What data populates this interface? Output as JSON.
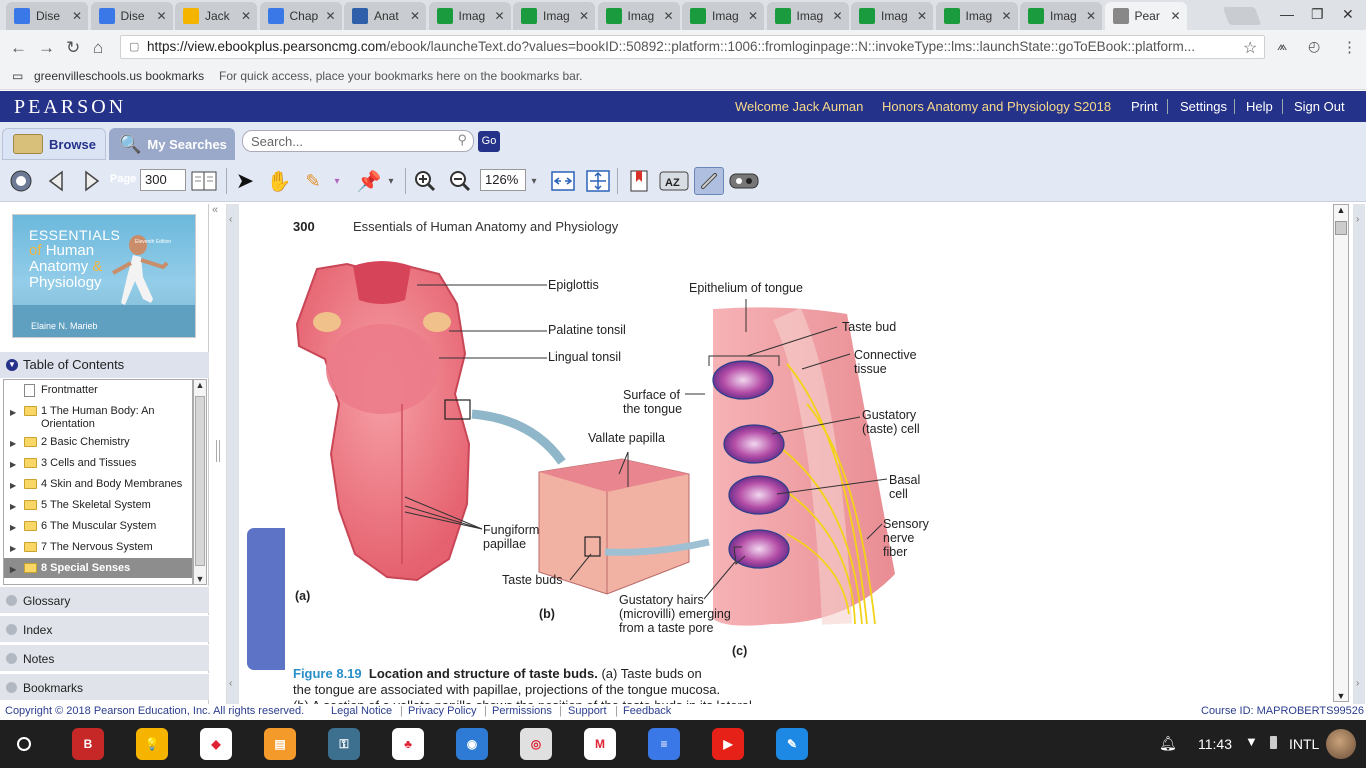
{
  "browser": {
    "tabs": [
      {
        "title": "Dise",
        "icon": "docs-icon",
        "color": "#3b78e7"
      },
      {
        "title": "Dise",
        "icon": "docs-icon",
        "color": "#3b78e7"
      },
      {
        "title": "Jack",
        "icon": "slides-icon",
        "color": "#f4b400"
      },
      {
        "title": "Chap",
        "icon": "docs-icon",
        "color": "#3b78e7"
      },
      {
        "title": "Anat",
        "icon": "classroom-icon",
        "color": "#2e5fa8"
      },
      {
        "title": "Imag",
        "icon": "iq-icon",
        "color": "#1a9c3e"
      },
      {
        "title": "Imag",
        "icon": "iq-icon",
        "color": "#1a9c3e"
      },
      {
        "title": "Imag",
        "icon": "iq-icon",
        "color": "#1a9c3e"
      },
      {
        "title": "Imag",
        "icon": "iq-icon",
        "color": "#1a9c3e"
      },
      {
        "title": "Imag",
        "icon": "iq-icon",
        "color": "#1a9c3e"
      },
      {
        "title": "Imag",
        "icon": "iq-icon",
        "color": "#1a9c3e"
      },
      {
        "title": "Imag",
        "icon": "iq-icon",
        "color": "#1a9c3e"
      },
      {
        "title": "Imag",
        "icon": "iq-icon",
        "color": "#1a9c3e"
      },
      {
        "title": "Pear",
        "icon": "page-icon",
        "color": "#888888",
        "active": true
      }
    ],
    "url_host": "https://view.ebookplus.pearsoncmg.com",
    "url_path": "/ebook/launcheText.do?values=bookID::50892::platform::1006::fromloginpage::N::invokeType::lms::launchState::goToEBook::platform...",
    "bookmarks_folder": "greenvilleschools.us bookmarks",
    "bookmarks_hint": "For quick access, place your bookmarks here on the bookmarks bar."
  },
  "header": {
    "logo": "PEARSON",
    "welcome": "Welcome Jack Auman",
    "course": "Honors Anatomy and Physiology S2018",
    "links": [
      "Print",
      "Settings",
      "Help",
      "Sign Out"
    ]
  },
  "toolbar": {
    "browse_label": "Browse",
    "searches_label": "My Searches",
    "search_placeholder": "Search...",
    "go_label": "Go",
    "page_label": "Page",
    "page_value": "300",
    "zoom_value": "126%"
  },
  "sidebar": {
    "cover": {
      "line1": "ESSENTIALS",
      "of": "of",
      "line2": "Human",
      "line3": "Anatomy",
      "amp": "&",
      "line4": "Physiology",
      "author": "Elaine N. Marieb",
      "edition": "Eleventh Edition"
    },
    "toc_title": "Table of Contents",
    "toc_items": [
      {
        "label": "Frontmatter",
        "kind": "page"
      },
      {
        "label": "1 The Human Body: An",
        "label2": "Orientation",
        "kind": "folder"
      },
      {
        "label": "2 Basic Chemistry",
        "kind": "folder"
      },
      {
        "label": "3 Cells and Tissues",
        "kind": "folder"
      },
      {
        "label": "4 Skin and Body Membranes",
        "kind": "folder"
      },
      {
        "label": "5 The Skeletal System",
        "kind": "folder"
      },
      {
        "label": "6 The Muscular System",
        "kind": "folder"
      },
      {
        "label": "7 The Nervous System",
        "kind": "folder"
      },
      {
        "label": "8 Special Senses",
        "kind": "folder",
        "selected": true
      }
    ],
    "sections": [
      "Glossary",
      "Index",
      "Notes",
      "Bookmarks"
    ]
  },
  "page": {
    "number": "300",
    "running_head": "Essentials of Human Anatomy and Physiology",
    "figure_labels": {
      "epiglottis": "Epiglottis",
      "palatine": "Palatine tonsil",
      "lingual": "Lingual tonsil",
      "fungiform1": "Fungiform",
      "fungiform2": "papillae",
      "a": "(a)",
      "vallate": "Vallate papilla",
      "taste_buds": "Taste buds",
      "b": "(b)",
      "surface1": "Surface of",
      "surface2": "the tongue",
      "epithelium": "Epithelium of tongue",
      "taste_bud": "Taste bud",
      "connective1": "Connective",
      "connective2": "tissue",
      "gustatory1": "Gustatory",
      "gustatory2": "(taste) cell",
      "basal1": "Basal",
      "basal2": "cell",
      "sensory1": "Sensory",
      "sensory2": "nerve",
      "sensory3": "fiber",
      "hairs1": "Gustatory hairs",
      "hairs2": "(microvilli) emerging",
      "hairs3": "from a taste pore",
      "c": "(c)"
    },
    "caption_num": "Figure 8.19",
    "caption_title": "Location and structure of taste buds.",
    "caption_text1": "(a) Taste buds on",
    "caption_text2": "the tongue are associated with papillae, projections of the tongue mucosa.",
    "caption_text3": "(b) A section of a vallate papilla shows the position of the taste buds in its lateral"
  },
  "footer": {
    "copyright": "Copyright © 2018 Pearson Education, Inc. All rights reserved.",
    "links": [
      "Legal Notice",
      "Privacy Policy",
      "Permissions",
      "Support",
      "Feedback"
    ],
    "course_id": "Course ID: MAPROBERTS99526"
  },
  "taskbar": {
    "apps": [
      {
        "name": "bully-app-icon",
        "color": "#c62828",
        "glyph": "B"
      },
      {
        "name": "keep-app-icon",
        "color": "#f6b400",
        "glyph": "💡"
      },
      {
        "name": "drive-app-icon",
        "color": "#ffffff",
        "glyph": "◆"
      },
      {
        "name": "app4-icon",
        "color": "#f39a2b",
        "glyph": "▤"
      },
      {
        "name": "lock-app-icon",
        "color": "#3d6f8e",
        "glyph": "⚿"
      },
      {
        "name": "tree-app-icon",
        "color": "#ffffff",
        "glyph": "♣"
      },
      {
        "name": "classroom-app-icon",
        "color": "#2e7bd6",
        "glyph": "◉"
      },
      {
        "name": "chrome-app-icon",
        "color": "#e0e0e0",
        "glyph": "◎"
      },
      {
        "name": "gmail-app-icon",
        "color": "#ffffff",
        "glyph": "M"
      },
      {
        "name": "docs-app-icon",
        "color": "#3b78e7",
        "glyph": "≡"
      },
      {
        "name": "youtube-app-icon",
        "color": "#e62117",
        "glyph": "▶"
      },
      {
        "name": "draw-app-icon",
        "color": "#1e88e5",
        "glyph": "✎"
      }
    ],
    "time": "11:43",
    "input": "INTL"
  }
}
